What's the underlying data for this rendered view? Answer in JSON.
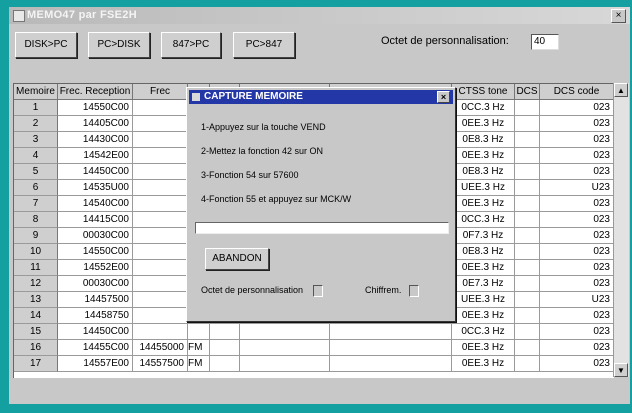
{
  "window": {
    "title": "MEMO47 par FSE2H",
    "close": "×"
  },
  "toolbar": {
    "buttons": [
      "DISK>PC",
      "PC>DISK",
      "847>PC",
      "PC>847"
    ],
    "octet_label": "Octet de personnalisation:",
    "octet_value": "40"
  },
  "table": {
    "headers": [
      "Memoire",
      "Frec. Reception",
      "Frec",
      "",
      "",
      "",
      "",
      "CTSS tone",
      "DCS",
      "DCS code"
    ],
    "rows": [
      {
        "mem": "1",
        "rx": "14550C00",
        "tx": "",
        "mode": "",
        "ctss": "0CC.3 Hz",
        "dcs": "",
        "code": "023"
      },
      {
        "mem": "2",
        "rx": "14405C00",
        "tx": "",
        "mode": "",
        "ctss": "0EE.3 Hz",
        "dcs": "",
        "code": "023"
      },
      {
        "mem": "3",
        "rx": "14430C00",
        "tx": "",
        "mode": "",
        "ctss": "0E8.3 Hz",
        "dcs": "",
        "code": "023"
      },
      {
        "mem": "4",
        "rx": "14542E00",
        "tx": "",
        "mode": "",
        "ctss": "0EE.3 Hz",
        "dcs": "",
        "code": "023"
      },
      {
        "mem": "5",
        "rx": "14450C00",
        "tx": "",
        "mode": "",
        "ctss": "0E8.3 Hz",
        "dcs": "",
        "code": "023"
      },
      {
        "mem": "6",
        "rx": "14535U00",
        "tx": "",
        "mode": "",
        "ctss": "UEE.3 Hz",
        "dcs": "",
        "code": "U23"
      },
      {
        "mem": "7",
        "rx": "14540C00",
        "tx": "",
        "mode": "",
        "ctss": "0EE.3 Hz",
        "dcs": "",
        "code": "023"
      },
      {
        "mem": "8",
        "rx": "14415C00",
        "tx": "",
        "mode": "",
        "ctss": "0CC.3 Hz",
        "dcs": "",
        "code": "023"
      },
      {
        "mem": "9",
        "rx": "00030C00",
        "tx": "",
        "mode": "",
        "ctss": "0F7.3 Hz",
        "dcs": "",
        "code": "023"
      },
      {
        "mem": "10",
        "rx": "14550C00",
        "tx": "",
        "mode": "",
        "ctss": "0E8.3 Hz",
        "dcs": "",
        "code": "023"
      },
      {
        "mem": "11",
        "rx": "14552E00",
        "tx": "",
        "mode": "",
        "ctss": "0EE.3 Hz",
        "dcs": "",
        "code": "023"
      },
      {
        "mem": "12",
        "rx": "00030C00",
        "tx": "",
        "mode": "",
        "ctss": "0E7.3 Hz",
        "dcs": "",
        "code": "023"
      },
      {
        "mem": "13",
        "rx": "14457500",
        "tx": "",
        "mode": "",
        "ctss": "UEE.3 Hz",
        "dcs": "",
        "code": "U23"
      },
      {
        "mem": "14",
        "rx": "14458750",
        "tx": "",
        "mode": "",
        "ctss": "0EE.3 Hz",
        "dcs": "",
        "code": "023"
      },
      {
        "mem": "15",
        "rx": "14450C00",
        "tx": "",
        "mode": "",
        "ctss": "0CC.3 Hz",
        "dcs": "",
        "code": "023"
      },
      {
        "mem": "16",
        "rx": "14455C00",
        "tx": "14455000",
        "mode": "FM",
        "ctss": "0EE.3 Hz",
        "dcs": "",
        "code": "023"
      },
      {
        "mem": "17",
        "rx": "14557E00",
        "tx": "14557500",
        "mode": "FM",
        "ctss": "0EE.3 Hz",
        "dcs": "",
        "code": "023"
      }
    ]
  },
  "dialog": {
    "title": "CAPTURE MEMOIRE",
    "close": "×",
    "steps": [
      "1-Appuyez sur la touche VEND",
      "2-Mettez la fonction 42 sur ON",
      "3-Fonction 54 sur 57600",
      "4-Fonction 55 et appuyez sur MCK/W"
    ],
    "progress": 0,
    "abandon_label": "ABANDON",
    "octet_label": "Octet de personnalisation",
    "chiffrement_label": "Chiffrem."
  },
  "scroll": {
    "up": "▲",
    "down": "▼"
  },
  "colors": {
    "desktop": "#14a0a0",
    "dialog_title": "#2437a6"
  }
}
